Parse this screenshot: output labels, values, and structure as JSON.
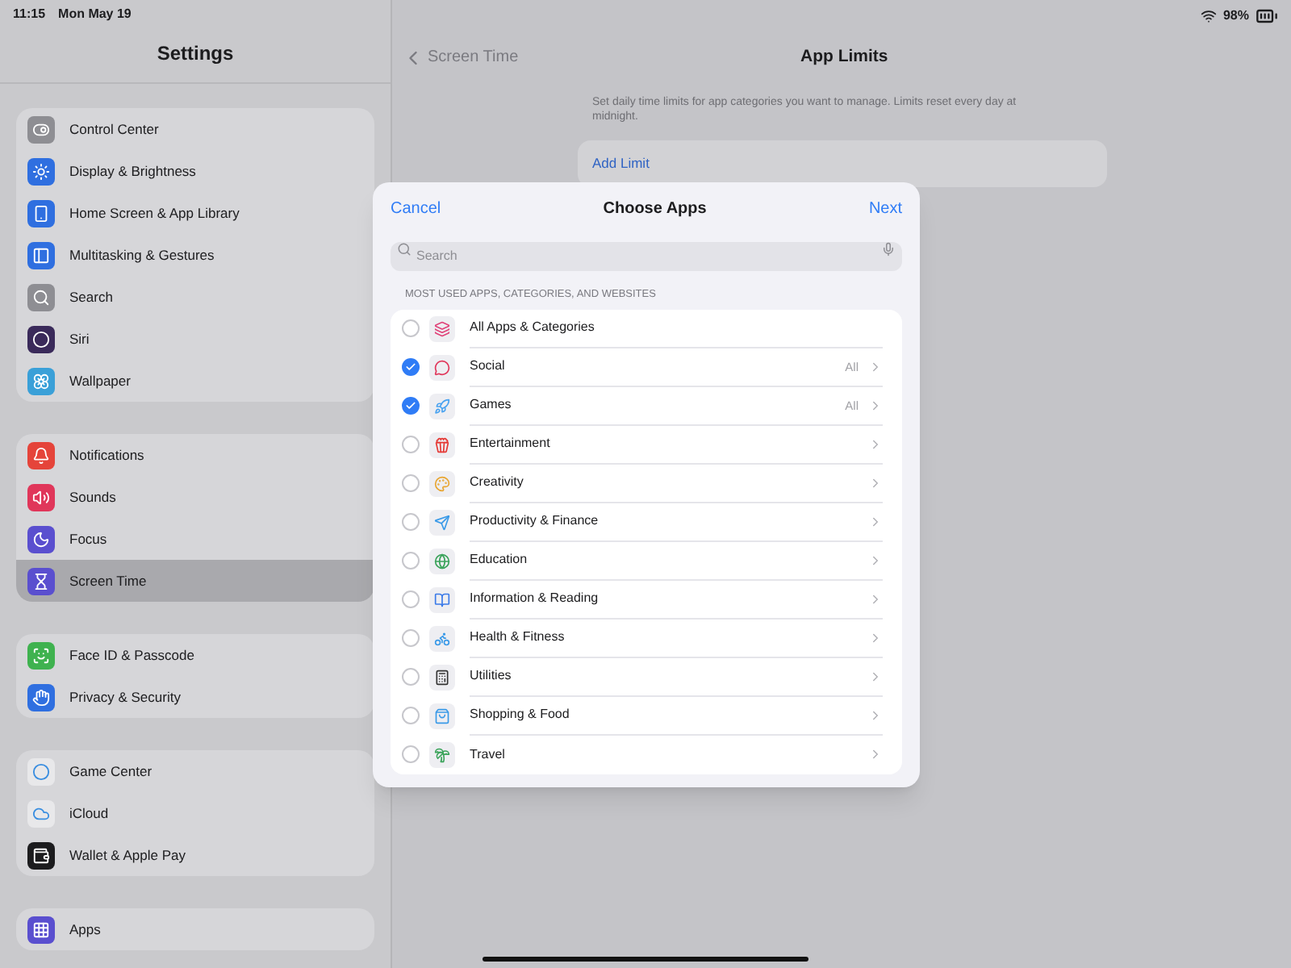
{
  "status_bar": {
    "time": "11:15",
    "date": "Mon May 19",
    "battery": "98%"
  },
  "sidebar": {
    "title": "Settings",
    "groups": [
      {
        "items": [
          {
            "label": "Control Center",
            "selected": false
          },
          {
            "label": "Display & Brightness",
            "selected": false
          },
          {
            "label": "Home Screen & App Library",
            "selected": false
          },
          {
            "label": "Multitasking & Gestures",
            "selected": false
          },
          {
            "label": "Search",
            "selected": false
          },
          {
            "label": "Siri",
            "selected": false
          },
          {
            "label": "Wallpaper",
            "selected": false
          }
        ]
      },
      {
        "items": [
          {
            "label": "Notifications",
            "selected": false
          },
          {
            "label": "Sounds",
            "selected": false
          },
          {
            "label": "Focus",
            "selected": false
          },
          {
            "label": "Screen Time",
            "selected": true
          }
        ]
      },
      {
        "items": [
          {
            "label": "Face ID & Passcode",
            "selected": false
          },
          {
            "label": "Privacy & Security",
            "selected": false
          }
        ]
      },
      {
        "items": [
          {
            "label": "Game Center",
            "selected": false
          },
          {
            "label": "iCloud",
            "selected": false
          },
          {
            "label": "Wallet & Apple Pay",
            "selected": false
          }
        ]
      },
      {
        "items": [
          {
            "label": "Apps",
            "selected": false
          }
        ]
      }
    ]
  },
  "detail": {
    "back": "Screen Time",
    "title": "App Limits",
    "description": "Set daily time limits for app categories you want to manage. Limits reset every day at midnight.",
    "add_limit": "Add Limit"
  },
  "sheet": {
    "cancel": "Cancel",
    "title": "Choose Apps",
    "next": "Next",
    "search": {
      "placeholder": "Search"
    },
    "section": "MOST USED APPS, CATEGORIES, AND WEBSITES",
    "rows": [
      {
        "label": "All Apps & Categories",
        "checked": false
      },
      {
        "label": "Social",
        "checked": true,
        "detail": "All",
        "chevron": true
      },
      {
        "label": "Games",
        "checked": true,
        "detail": "All",
        "chevron": true
      },
      {
        "label": "Entertainment",
        "checked": false,
        "chevron": true
      },
      {
        "label": "Creativity",
        "checked": false,
        "chevron": true
      },
      {
        "label": "Productivity & Finance",
        "checked": false,
        "chevron": true
      },
      {
        "label": "Education",
        "checked": false,
        "chevron": true
      },
      {
        "label": "Information & Reading",
        "checked": false,
        "chevron": true
      },
      {
        "label": "Health & Fitness",
        "checked": false,
        "chevron": true
      },
      {
        "label": "Utilities",
        "checked": false,
        "chevron": true
      },
      {
        "label": "Shopping & Food",
        "checked": false,
        "chevron": true
      },
      {
        "label": "Travel",
        "checked": false,
        "chevron": true
      }
    ]
  }
}
